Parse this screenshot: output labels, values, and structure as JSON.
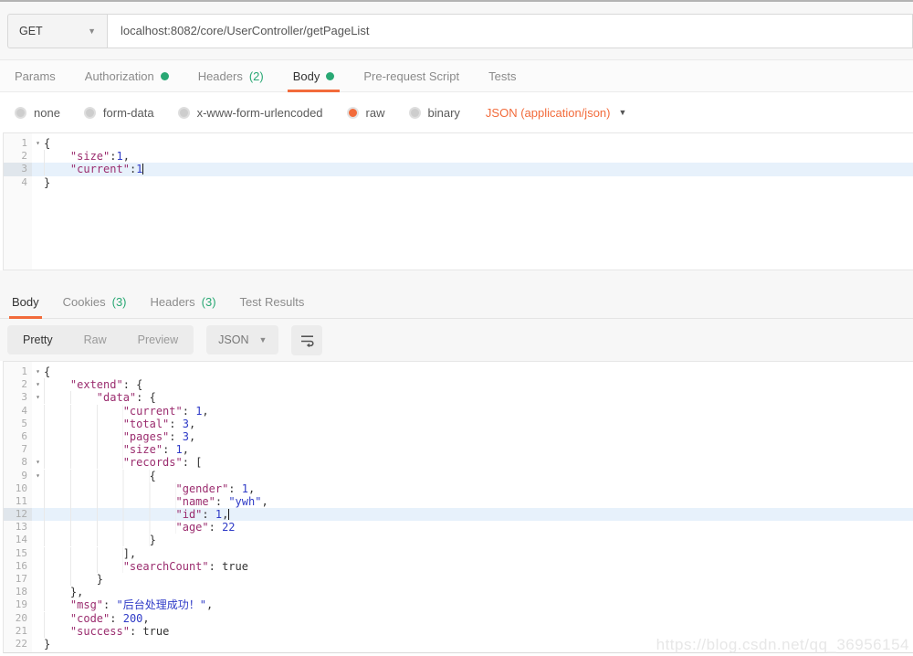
{
  "colors": {
    "accent_orange": "#F26B3B",
    "status_green": "#29A874",
    "json_key": "#9B2D6F",
    "json_value_blue": "#2F3BC7"
  },
  "request_bar": {
    "method": "GET",
    "url": "localhost:8082/core/UserController/getPageList"
  },
  "request_tabs": [
    {
      "label": "Params"
    },
    {
      "label": "Authorization",
      "dot": true
    },
    {
      "label": "Headers",
      "suffix": "(2)"
    },
    {
      "label": "Body",
      "dot": true,
      "active": true
    },
    {
      "label": "Pre-request Script"
    },
    {
      "label": "Tests"
    }
  ],
  "body_type": {
    "options": [
      {
        "label": "none"
      },
      {
        "label": "form-data"
      },
      {
        "label": "x-www-form-urlencoded"
      },
      {
        "label": "raw",
        "selected": true
      },
      {
        "label": "binary"
      }
    ],
    "format_label": "JSON (application/json)"
  },
  "request_editor": {
    "lines": [
      {
        "n": 1,
        "fold": true,
        "t": [
          [
            "p",
            "{"
          ]
        ]
      },
      {
        "n": 2,
        "t": [
          [
            "w",
            "    "
          ],
          [
            "k",
            "\"size\""
          ],
          [
            "p",
            ":"
          ],
          [
            "n",
            "1"
          ],
          [
            "p",
            ","
          ]
        ]
      },
      {
        "n": 3,
        "hl": true,
        "t": [
          [
            "w",
            "    "
          ],
          [
            "k",
            "\"current\""
          ],
          [
            "p",
            ":"
          ],
          [
            "n",
            "1"
          ],
          [
            "c",
            ""
          ]
        ]
      },
      {
        "n": 4,
        "t": [
          [
            "p",
            "}"
          ]
        ]
      }
    ]
  },
  "response_tabs": [
    {
      "label": "Body",
      "active": true
    },
    {
      "label": "Cookies",
      "suffix": "(3)"
    },
    {
      "label": "Headers",
      "suffix": "(3)"
    },
    {
      "label": "Test Results"
    }
  ],
  "response_toolbar": {
    "views": [
      {
        "label": "Pretty",
        "active": true
      },
      {
        "label": "Raw"
      },
      {
        "label": "Preview"
      }
    ],
    "format": "JSON"
  },
  "response_editor": {
    "lines": [
      {
        "n": 1,
        "fold": true,
        "t": [
          [
            "p",
            "{"
          ]
        ]
      },
      {
        "n": 2,
        "fold": true,
        "t": [
          [
            "w",
            "    "
          ],
          [
            "k",
            "\"extend\""
          ],
          [
            "p",
            ": {"
          ]
        ]
      },
      {
        "n": 3,
        "fold": true,
        "t": [
          [
            "w",
            "        "
          ],
          [
            "k",
            "\"data\""
          ],
          [
            "p",
            ": {"
          ]
        ]
      },
      {
        "n": 4,
        "t": [
          [
            "w",
            "            "
          ],
          [
            "k",
            "\"current\""
          ],
          [
            "p",
            ": "
          ],
          [
            "n",
            "1"
          ],
          [
            "p",
            ","
          ]
        ]
      },
      {
        "n": 5,
        "t": [
          [
            "w",
            "            "
          ],
          [
            "k",
            "\"total\""
          ],
          [
            "p",
            ": "
          ],
          [
            "n",
            "3"
          ],
          [
            "p",
            ","
          ]
        ]
      },
      {
        "n": 6,
        "t": [
          [
            "w",
            "            "
          ],
          [
            "k",
            "\"pages\""
          ],
          [
            "p",
            ": "
          ],
          [
            "n",
            "3"
          ],
          [
            "p",
            ","
          ]
        ]
      },
      {
        "n": 7,
        "t": [
          [
            "w",
            "            "
          ],
          [
            "k",
            "\"size\""
          ],
          [
            "p",
            ": "
          ],
          [
            "n",
            "1"
          ],
          [
            "p",
            ","
          ]
        ]
      },
      {
        "n": 8,
        "fold": true,
        "t": [
          [
            "w",
            "            "
          ],
          [
            "k",
            "\"records\""
          ],
          [
            "p",
            ": ["
          ]
        ]
      },
      {
        "n": 9,
        "fold": true,
        "t": [
          [
            "w",
            "                "
          ],
          [
            "p",
            "{"
          ]
        ]
      },
      {
        "n": 10,
        "t": [
          [
            "w",
            "                    "
          ],
          [
            "k",
            "\"gender\""
          ],
          [
            "p",
            ": "
          ],
          [
            "n",
            "1"
          ],
          [
            "p",
            ","
          ]
        ]
      },
      {
        "n": 11,
        "t": [
          [
            "w",
            "                    "
          ],
          [
            "k",
            "\"name\""
          ],
          [
            "p",
            ": "
          ],
          [
            "s",
            "\"ywh\""
          ],
          [
            "p",
            ","
          ]
        ]
      },
      {
        "n": 12,
        "hl": true,
        "t": [
          [
            "w",
            "                    "
          ],
          [
            "k",
            "\"id\""
          ],
          [
            "p",
            ": "
          ],
          [
            "n",
            "1"
          ],
          [
            "p",
            ","
          ],
          [
            "c",
            ""
          ]
        ]
      },
      {
        "n": 13,
        "t": [
          [
            "w",
            "                    "
          ],
          [
            "k",
            "\"age\""
          ],
          [
            "p",
            ": "
          ],
          [
            "n",
            "22"
          ]
        ]
      },
      {
        "n": 14,
        "t": [
          [
            "w",
            "                "
          ],
          [
            "p",
            "}"
          ]
        ]
      },
      {
        "n": 15,
        "t": [
          [
            "w",
            "            "
          ],
          [
            "p",
            "],"
          ]
        ]
      },
      {
        "n": 16,
        "t": [
          [
            "w",
            "            "
          ],
          [
            "k",
            "\"searchCount\""
          ],
          [
            "p",
            ": "
          ],
          [
            "b",
            "true"
          ]
        ]
      },
      {
        "n": 17,
        "t": [
          [
            "w",
            "        "
          ],
          [
            "p",
            "}"
          ]
        ]
      },
      {
        "n": 18,
        "t": [
          [
            "w",
            "    "
          ],
          [
            "p",
            "},"
          ]
        ]
      },
      {
        "n": 19,
        "t": [
          [
            "w",
            "    "
          ],
          [
            "k",
            "\"msg\""
          ],
          [
            "p",
            ": "
          ],
          [
            "s",
            "\"后台处理成功！\""
          ],
          [
            "p",
            ","
          ]
        ]
      },
      {
        "n": 20,
        "t": [
          [
            "w",
            "    "
          ],
          [
            "k",
            "\"code\""
          ],
          [
            "p",
            ": "
          ],
          [
            "n",
            "200"
          ],
          [
            "p",
            ","
          ]
        ]
      },
      {
        "n": 21,
        "t": [
          [
            "w",
            "    "
          ],
          [
            "k",
            "\"success\""
          ],
          [
            "p",
            ": "
          ],
          [
            "b",
            "true"
          ]
        ]
      },
      {
        "n": 22,
        "t": [
          [
            "p",
            "}"
          ]
        ]
      }
    ]
  },
  "watermark": "https://blog.csdn.net/qq_36956154"
}
